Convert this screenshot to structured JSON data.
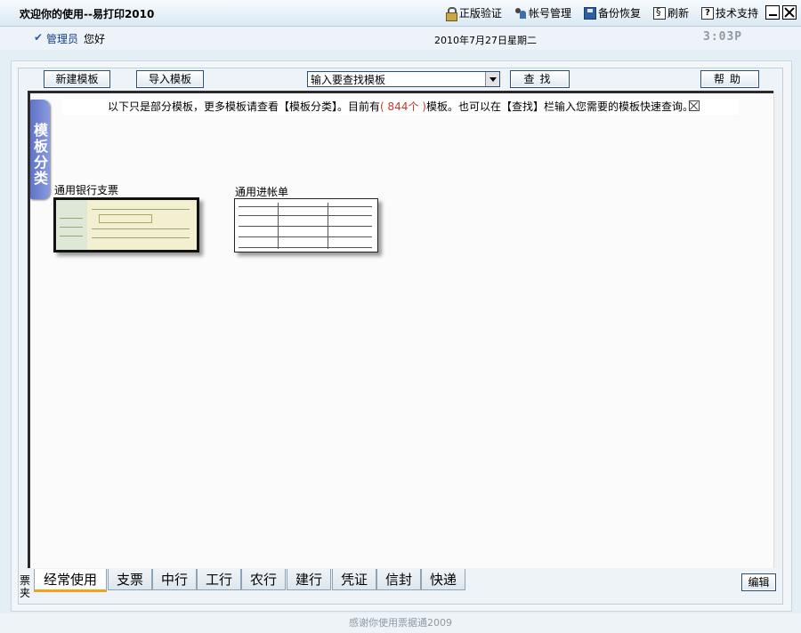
{
  "window": {
    "title": "欢迎你的使用--易打印2010",
    "menu": [
      "正版验证",
      "帐号管理",
      "备份恢复",
      "刷新",
      "技术支持"
    ]
  },
  "userbar": {
    "role": "管理员",
    "greeting": "您好",
    "date": "2010年7月27日星期二",
    "clock": "3:03P"
  },
  "toolbar": {
    "new_label": "新建模板",
    "import_label": "导入模板",
    "search_value": "输入要查找模板",
    "find_label": "查找",
    "help_label": "帮助"
  },
  "notice": {
    "prefix": "以下只是部分模板，更多模板请查看【模板分类】。目前有",
    "count": "( 844个 )",
    "suffix": "模板。也可以在【查找】栏输入您需要的模板快速查询。"
  },
  "category_tab": "模板分类",
  "templates": [
    {
      "name": "通用银行支票",
      "thumb": "cheque"
    },
    {
      "name": "通用进帐单",
      "thumb": "deposit-slip"
    }
  ],
  "bottom": {
    "side_label": "票夹",
    "tabs": [
      "经常使用",
      "支票",
      "中行",
      "工行",
      "农行",
      "建行",
      "凭证",
      "信封",
      "快递"
    ],
    "active_tab": "经常使用",
    "edit_label": "编辑"
  },
  "footer": "感谢你使用票据通2009",
  "colors": {
    "accent_tab": "#f2a11a",
    "count_red": "#c0392b",
    "category_tab": "#6f82d0"
  }
}
